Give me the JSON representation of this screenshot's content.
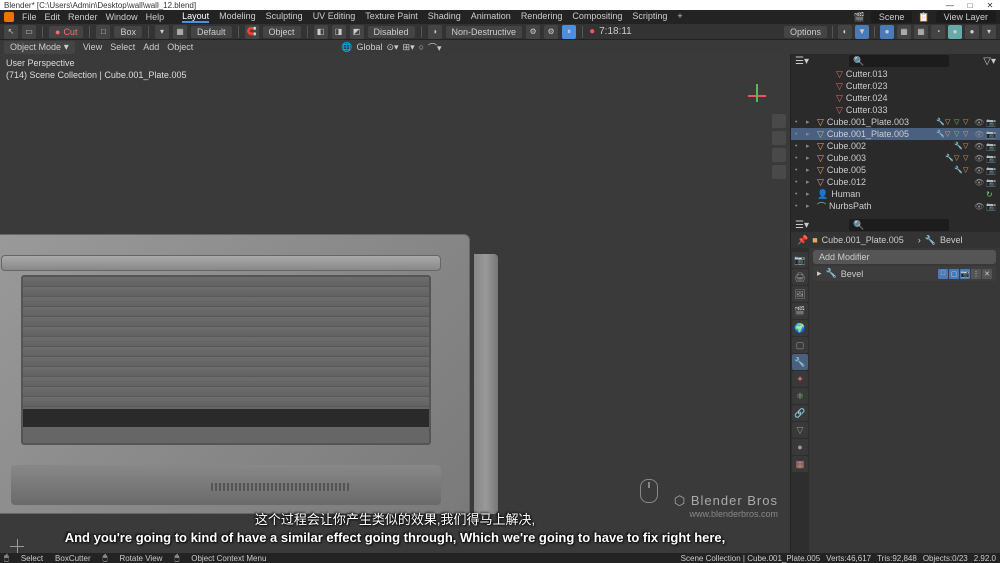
{
  "titlebar": {
    "title": "Blender* [C:\\Users\\Admin\\Desktop\\wall\\wall_12.blend]",
    "min": "—",
    "max": "□",
    "close": "✕"
  },
  "menubar": {
    "file": "File",
    "edit": "Edit",
    "render": "Render",
    "window": "Window",
    "help": "Help",
    "tabs": {
      "layout": "Layout",
      "modeling": "Modeling",
      "sculpting": "Sculpting",
      "uv": "UV Editing",
      "texture": "Texture Paint",
      "shading": "Shading",
      "animation": "Animation",
      "rendering": "Rendering",
      "compositing": "Compositing",
      "scripting": "Scripting",
      "plus": "+"
    },
    "scene_label": "Scene",
    "viewlayer_label": "View Layer"
  },
  "toolbar": {
    "cut": "Cut",
    "box": "Box",
    "default": "Default",
    "object": "Object",
    "disabled": "Disabled",
    "nondestructive": "Non-Destructive",
    "options": "Options",
    "time": "7:18:11"
  },
  "toolbar2": {
    "mode": "Object Mode",
    "view": "View",
    "select": "Select",
    "add": "Add",
    "object": "Object",
    "global": "Global"
  },
  "viewport": {
    "line1": "User Perspective",
    "line2": "(714) Scene Collection | Cube.001_Plate.005"
  },
  "outliner": {
    "items": [
      {
        "name": "Cutter.013",
        "indent": 3,
        "icon": "red"
      },
      {
        "name": "Cutter.023",
        "indent": 3,
        "icon": "red"
      },
      {
        "name": "Cutter.024",
        "indent": 3,
        "icon": "red"
      },
      {
        "name": "Cutter.033",
        "indent": 3,
        "icon": "red"
      }
    ],
    "objects": [
      {
        "name": "Cube.001_Plate.003",
        "mods": true
      },
      {
        "name": "Cube.001_Plate.005",
        "mods": true,
        "active": true
      },
      {
        "name": "Cube.002",
        "mods": true
      },
      {
        "name": "Cube.003",
        "mods": true
      },
      {
        "name": "Cube.005"
      },
      {
        "name": "Cube.012"
      }
    ],
    "armature": "Human",
    "curve": "NurbsPath"
  },
  "props": {
    "object_name": "Cube.001_Plate.005",
    "modifier_breadcrumb": "Bevel",
    "add_modifier": "Add Modifier",
    "bevel": "Bevel"
  },
  "subtitle": {
    "cn": "这个过程会让你产生类似的效果,我们得马上解决,",
    "en": "And you're going to kind of have a similar effect going through, Which we're going to have to fix right here,"
  },
  "watermark": {
    "brand": "Blender Bros",
    "url": "www.blenderbros.com"
  },
  "statusbar": {
    "select": "Select",
    "boxcutter": "BoxCutter",
    "rotate": "Rotate View",
    "context": "Object Context Menu",
    "collection": "Scene Collection | Cube.001_Plate.005",
    "verts": "Verts:46,617",
    "tris": "Tris:92,848",
    "objects": "Objects:0/23",
    "version": "2.92.0"
  }
}
